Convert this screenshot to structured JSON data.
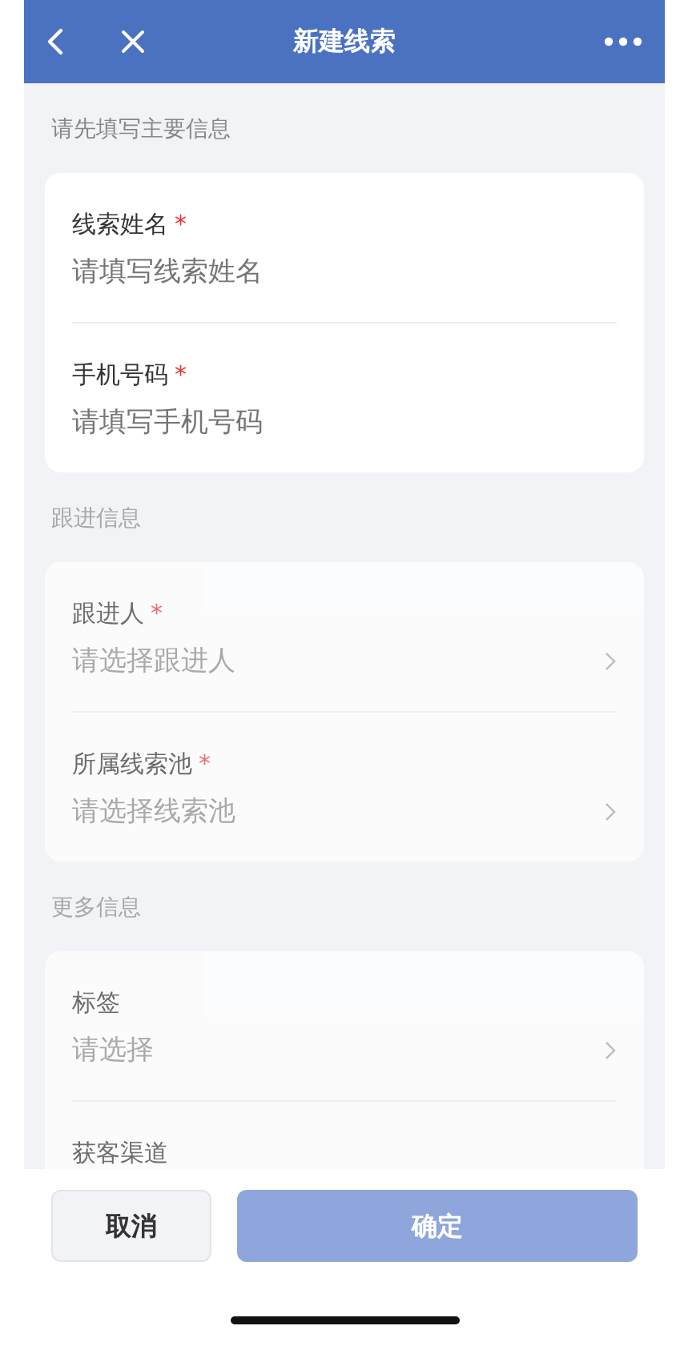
{
  "header": {
    "title": "新建线索"
  },
  "sections": [
    {
      "title": "请先填写主要信息",
      "disabled": false,
      "fields": [
        {
          "kind": "text",
          "label": "线索姓名",
          "required_mark": "*",
          "placeholder": "请填写线索姓名"
        },
        {
          "kind": "text",
          "label": "手机号码",
          "required_mark": "*",
          "placeholder": "请填写手机号码"
        }
      ]
    },
    {
      "title": "跟进信息",
      "disabled": true,
      "fields": [
        {
          "kind": "select",
          "label": "跟进人",
          "required_mark": "*",
          "placeholder": "请选择跟进人"
        },
        {
          "kind": "select",
          "label": "所属线索池",
          "required_mark": "*",
          "placeholder": "请选择线索池"
        }
      ]
    },
    {
      "title": "更多信息",
      "disabled": true,
      "fields": [
        {
          "kind": "select",
          "label": "标签",
          "placeholder": "请选择"
        },
        {
          "kind": "label_only",
          "label": "获客渠道"
        }
      ]
    }
  ],
  "footer": {
    "cancel": {
      "label": "取消",
      "disabled": false
    },
    "confirm": {
      "label": "确定",
      "disabled": true
    }
  }
}
